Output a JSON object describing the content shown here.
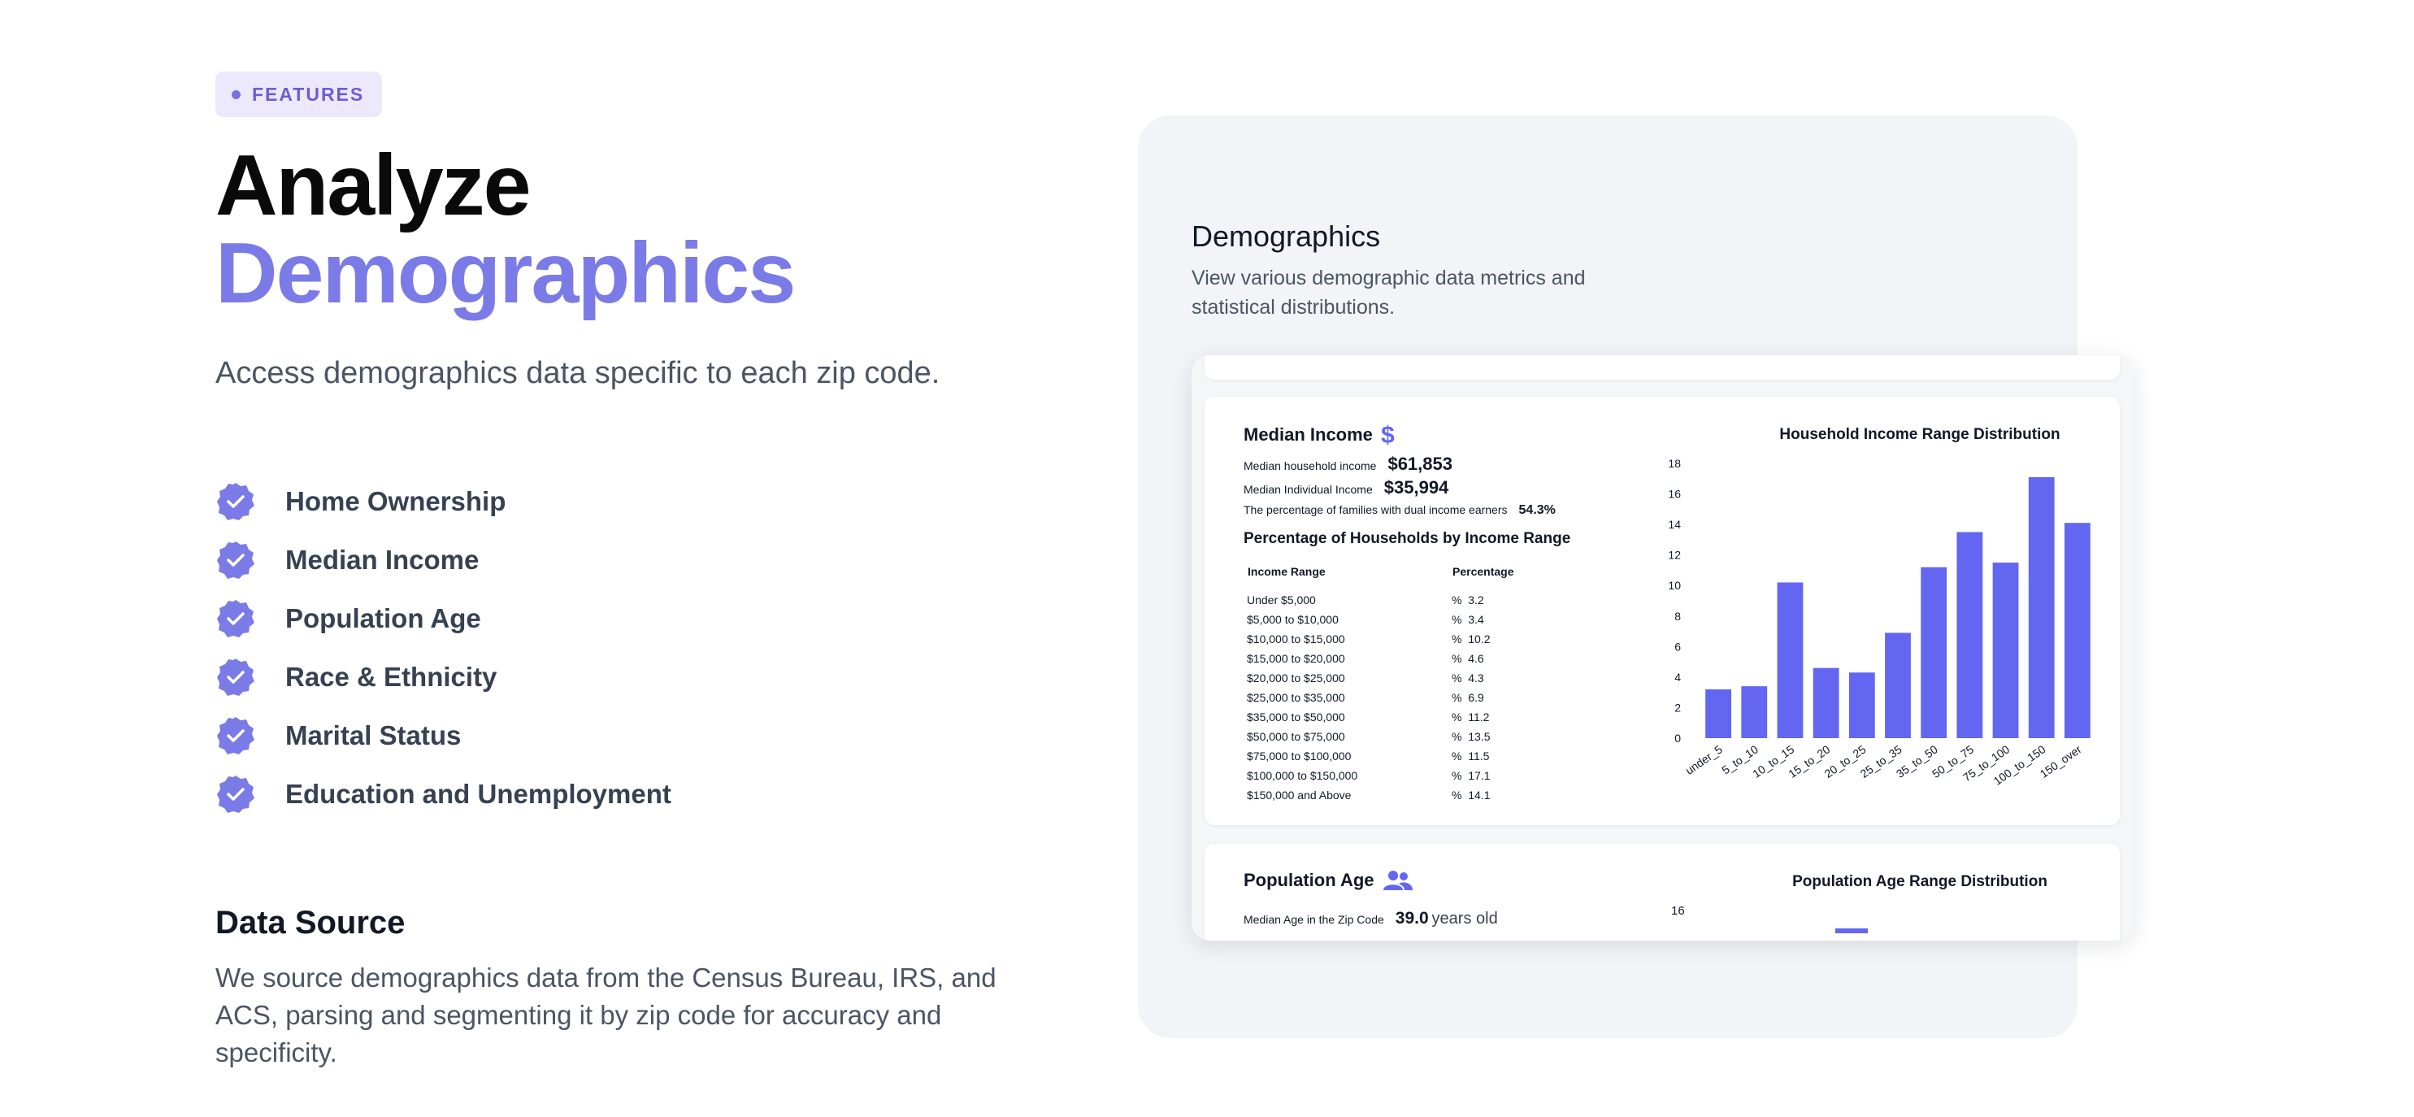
{
  "badge": {
    "label": "FEATURES"
  },
  "hero": {
    "title_line1": "Analyze",
    "title_line2": "Demographics",
    "lead": "Access demographics data specific to each zip code."
  },
  "features": [
    {
      "label": "Home Ownership"
    },
    {
      "label": "Median Income"
    },
    {
      "label": "Population Age"
    },
    {
      "label": "Race & Ethnicity"
    },
    {
      "label": "Marital Status"
    },
    {
      "label": "Education and Unemployment"
    }
  ],
  "data_source": {
    "title": "Data Source",
    "text": "We source demographics data from the Census Bureau, IRS, and ACS, parsing and segmenting it by zip code for accuracy and specificity."
  },
  "card": {
    "title": "Demographics",
    "subtitle": "View various demographic data metrics and statistical distributions."
  },
  "income_panel": {
    "title": "Median Income",
    "icon": "dollar-icon",
    "household_label": "Median household income",
    "household_value": "$61,853",
    "individual_label": "Median Individual Income",
    "individual_value": "$35,994",
    "dual_label": "The percentage of families with dual income earners",
    "dual_value": "54.3%",
    "table_title": "Percentage of Households by Income Range",
    "col_range": "Income Range",
    "col_percent": "Percentage",
    "rows": [
      {
        "range": "Under $5,000",
        "percent": "%  3.2"
      },
      {
        "range": "$5,000 to $10,000",
        "percent": "%  3.4"
      },
      {
        "range": "$10,000 to $15,000",
        "percent": "%  10.2"
      },
      {
        "range": "$15,000 to $20,000",
        "percent": "%  4.6"
      },
      {
        "range": "$20,000 to $25,000",
        "percent": "%  4.3"
      },
      {
        "range": "$25,000 to $35,000",
        "percent": "%  6.9"
      },
      {
        "range": "$35,000 to $50,000",
        "percent": "%  11.2"
      },
      {
        "range": "$50,000 to $75,000",
        "percent": "%  13.5"
      },
      {
        "range": "$75,000 to $100,000",
        "percent": "%  11.5"
      },
      {
        "range": "$100,000 to $150,000",
        "percent": "%  17.1"
      },
      {
        "range": "$150,000 and Above",
        "percent": "%  14.1"
      }
    ]
  },
  "age_panel": {
    "title": "Population Age",
    "icon": "users-icon",
    "median_label": "Median Age in the Zip Code",
    "median_value": "39.0",
    "median_unit": "years old",
    "chart_title": "Population Age Range Distribution",
    "first_tick": "16"
  },
  "colors": {
    "accent": "#6366F1",
    "brand_light": "#7B7BE8"
  },
  "chart_data": {
    "type": "bar",
    "title": "Household Income Range Distribution",
    "categories": [
      "under_5",
      "5_to_10",
      "10_to_15",
      "15_to_20",
      "20_to_25",
      "25_to_35",
      "35_to_50",
      "50_to_75",
      "75_to_100",
      "100_to_150",
      "150_over"
    ],
    "values": [
      3.2,
      3.4,
      10.2,
      4.6,
      4.3,
      6.9,
      11.2,
      13.5,
      11.5,
      17.1,
      14.1
    ],
    "yticks": [
      0,
      2,
      4,
      6,
      8,
      10,
      12,
      14,
      16,
      18
    ],
    "ylim": [
      0,
      18
    ],
    "xlabel": "",
    "ylabel": "",
    "grid": false,
    "color": "#6366F1"
  }
}
